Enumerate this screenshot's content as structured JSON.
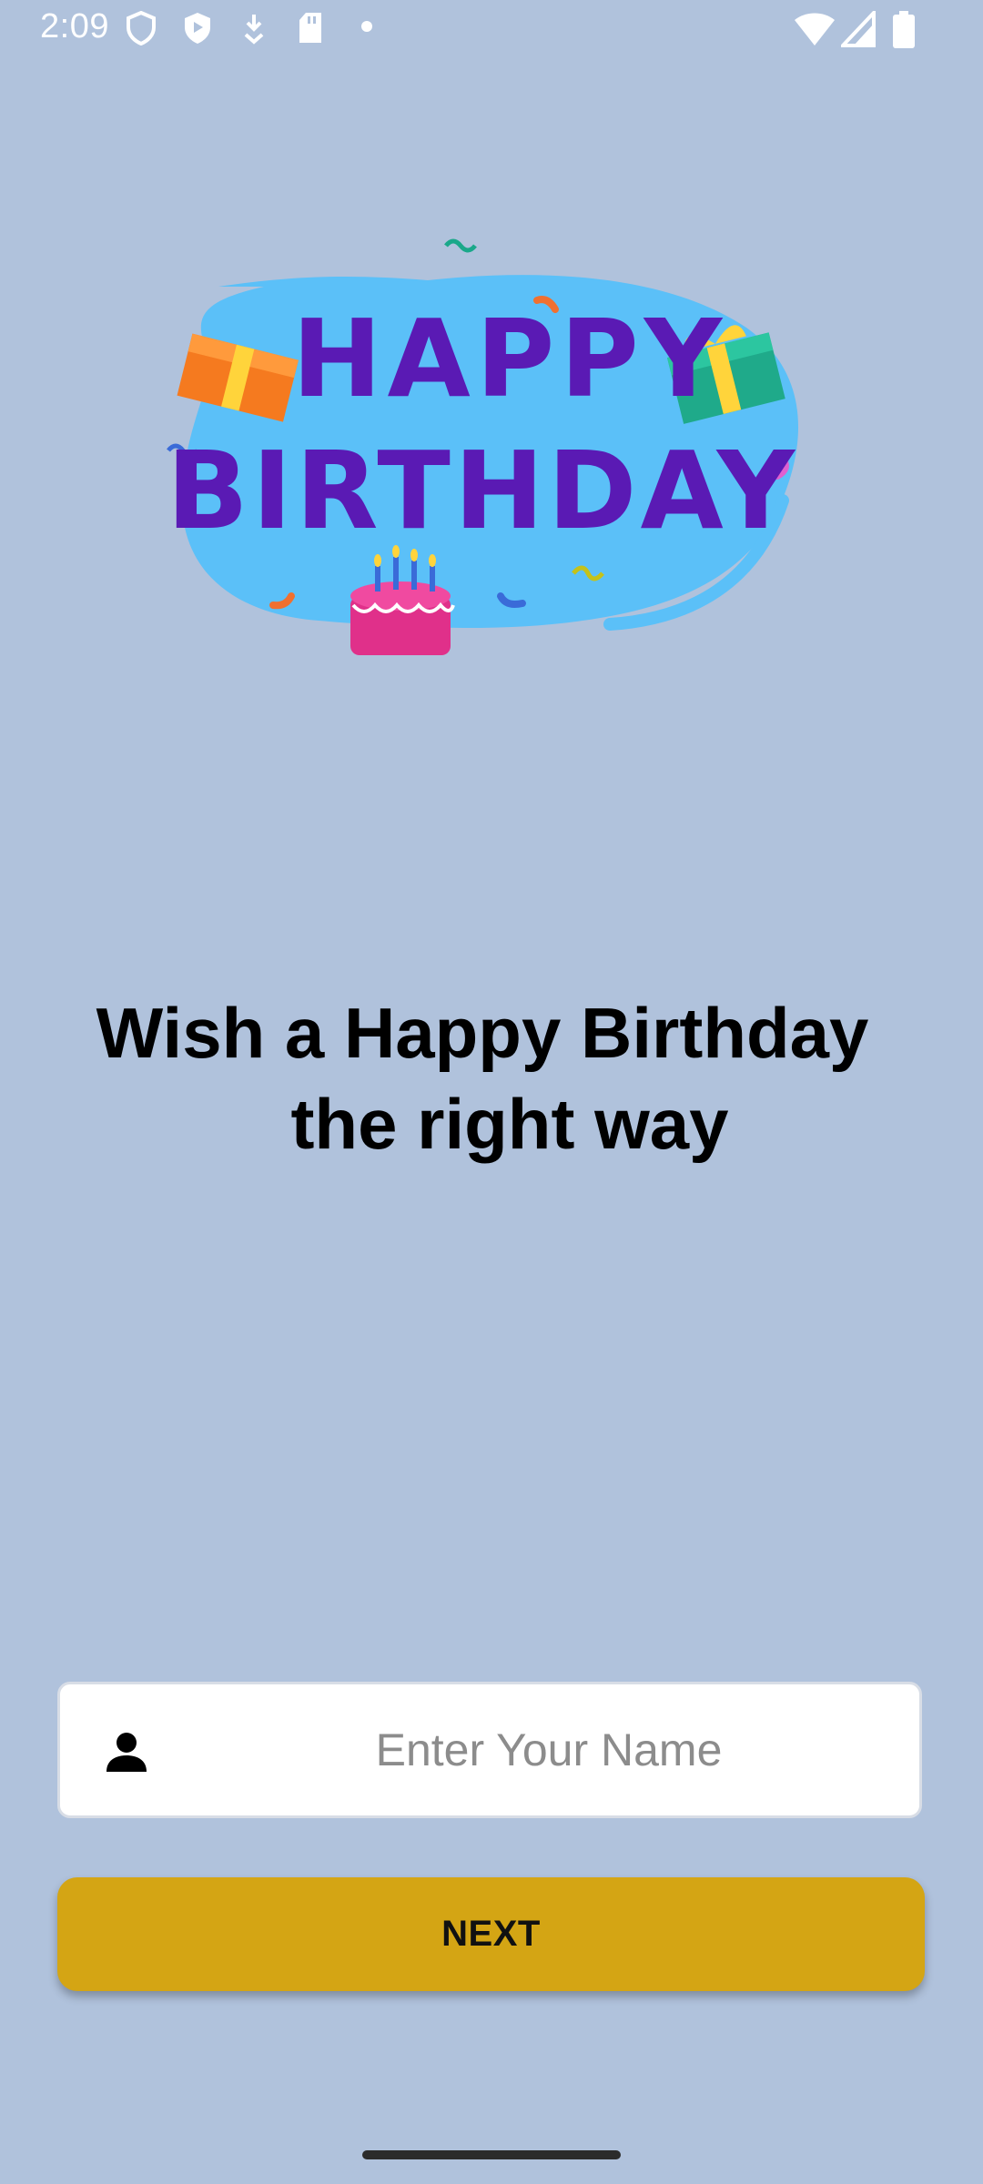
{
  "status_bar": {
    "time": "2:09",
    "left_icons": [
      "shield-icon",
      "play-protect-icon",
      "download-icon",
      "sd-card-icon",
      "dot-icon"
    ],
    "right_icons": [
      "wifi-icon",
      "signal-icon",
      "battery-icon"
    ]
  },
  "banner": {
    "line1": "HAPPY",
    "line2": "BIRTHDAY"
  },
  "headline": {
    "line1": "Wish a Happy Birthday",
    "line2": "the right way"
  },
  "name_field": {
    "placeholder": "Enter Your Name",
    "value": "",
    "icon": "person-icon"
  },
  "next_button": {
    "label": "NEXT"
  },
  "colors": {
    "background": "#b0c2dc",
    "button": "#d4a514",
    "banner_blob": "#5bc0f8",
    "banner_text": "#5a1ab4"
  }
}
